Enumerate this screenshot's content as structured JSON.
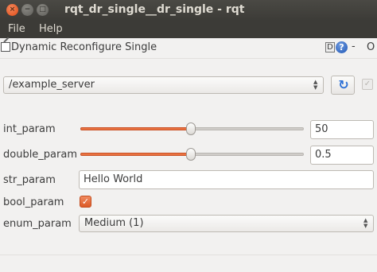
{
  "window": {
    "title": "rqt_dr_single__dr_single - rqt",
    "close_glyph": "×",
    "minimize_glyph": "−",
    "maximize_glyph": "□"
  },
  "menu": {
    "items": [
      {
        "label": "File"
      },
      {
        "label": "Help"
      }
    ]
  },
  "plugin": {
    "title": "Dynamic Reconfigure Single",
    "d_label": "D",
    "help_label": "?",
    "minimize_label": "-",
    "close_label": "O"
  },
  "server": {
    "selected": "/example_server",
    "refresh_icon": "refresh-icon",
    "refresh_glyph": "↻",
    "checkbox_glyph": "✓"
  },
  "params": {
    "int_param": {
      "label": "int_param",
      "value": "50",
      "slider_fraction": 0.5
    },
    "double_param": {
      "label": "double_param",
      "value": "0.5",
      "slider_fraction": 0.5
    },
    "str_param": {
      "label": "str_param",
      "value": "Hello World"
    },
    "bool_param": {
      "label": "bool_param",
      "checked": true,
      "glyph": "✓"
    },
    "enum_param": {
      "label": "enum_param",
      "selected": "Medium (1)"
    }
  },
  "colors": {
    "accent": "#e9713f",
    "titlebar": "#3c3b37",
    "background": "#f2f1f0"
  }
}
